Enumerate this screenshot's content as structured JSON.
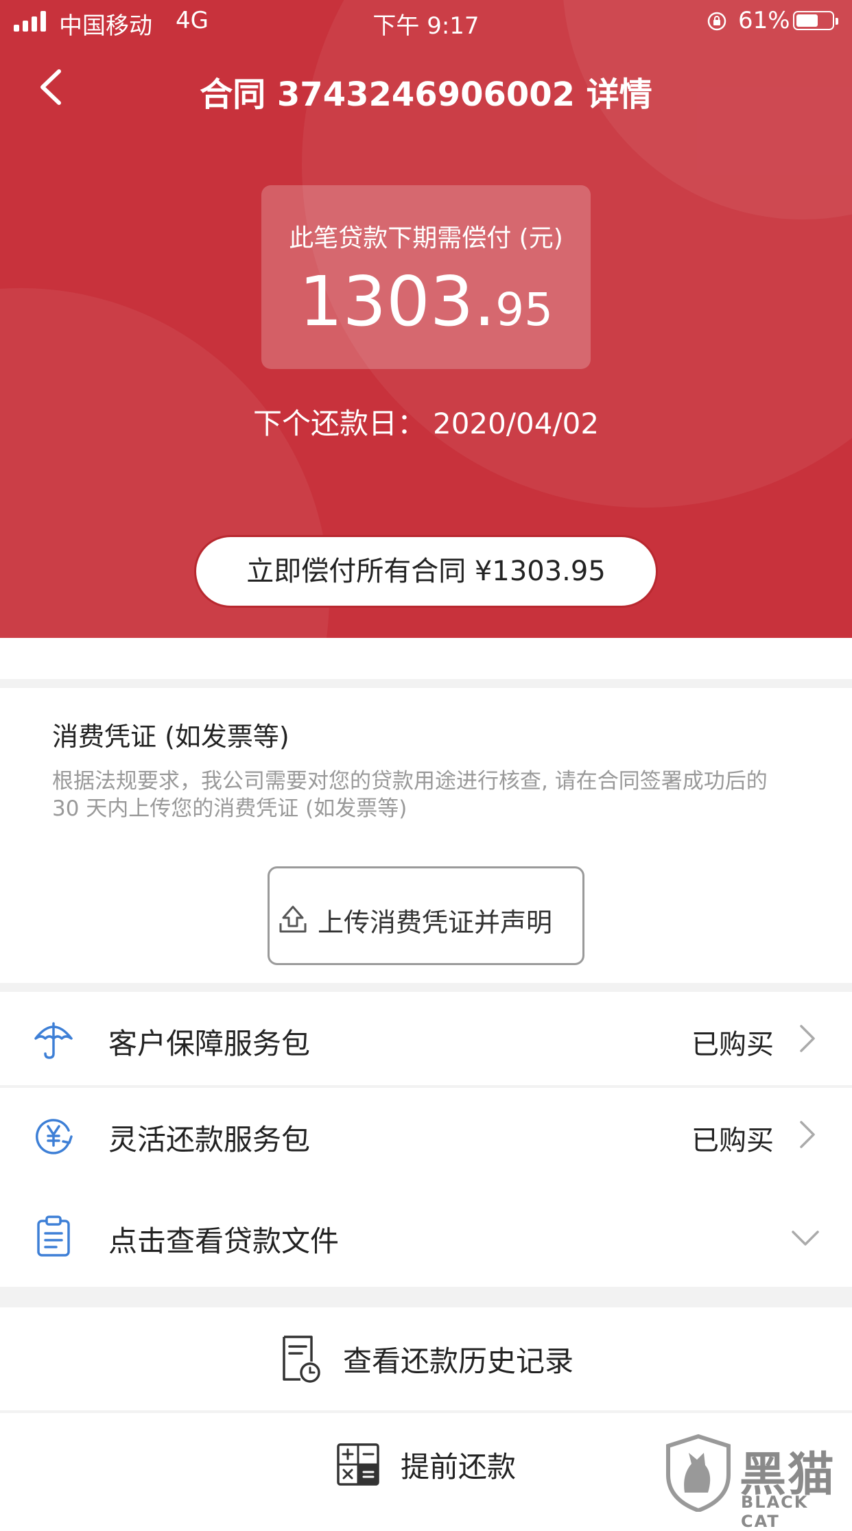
{
  "status_bar": {
    "carrier": "中国移动",
    "network": "4G",
    "time": "下午 9:17",
    "battery": "61%",
    "battery_level": 0.61
  },
  "header": {
    "title": "合同 3743246906002 详情"
  },
  "summary": {
    "label": "此笔贷款下期需偿付 (元)",
    "amount_integer": "1303.",
    "amount_decimal": "95",
    "due_label": "下个还款日：",
    "due_date": "2020/04/02",
    "pay_all_button": "立即偿付所有合同 ¥1303.95"
  },
  "voucher": {
    "title": "消费凭证 (如发票等)",
    "description": "根据法规要求，我公司需要对您的贷款用途进行核查, 请在合同签署成功后的 30 天内上传您的消费凭证 (如发票等)",
    "upload_button": "上传消费凭证并声明"
  },
  "services": [
    {
      "label": "客户保障服务包",
      "value": "已购买",
      "icon": "umbrella-icon"
    },
    {
      "label": "灵活还款服务包",
      "value": "已购买",
      "icon": "yen-cycle-icon"
    },
    {
      "label": "点击查看贷款文件",
      "icon": "clipboard-icon"
    }
  ],
  "actions": {
    "history": "查看还款历史记录",
    "prepay": "提前还款"
  },
  "watermark": {
    "zh": "黑猫",
    "en": "BLACK CAT"
  },
  "colors": {
    "hero": "#c8323c",
    "accent_blue": "#3d7fd6"
  }
}
